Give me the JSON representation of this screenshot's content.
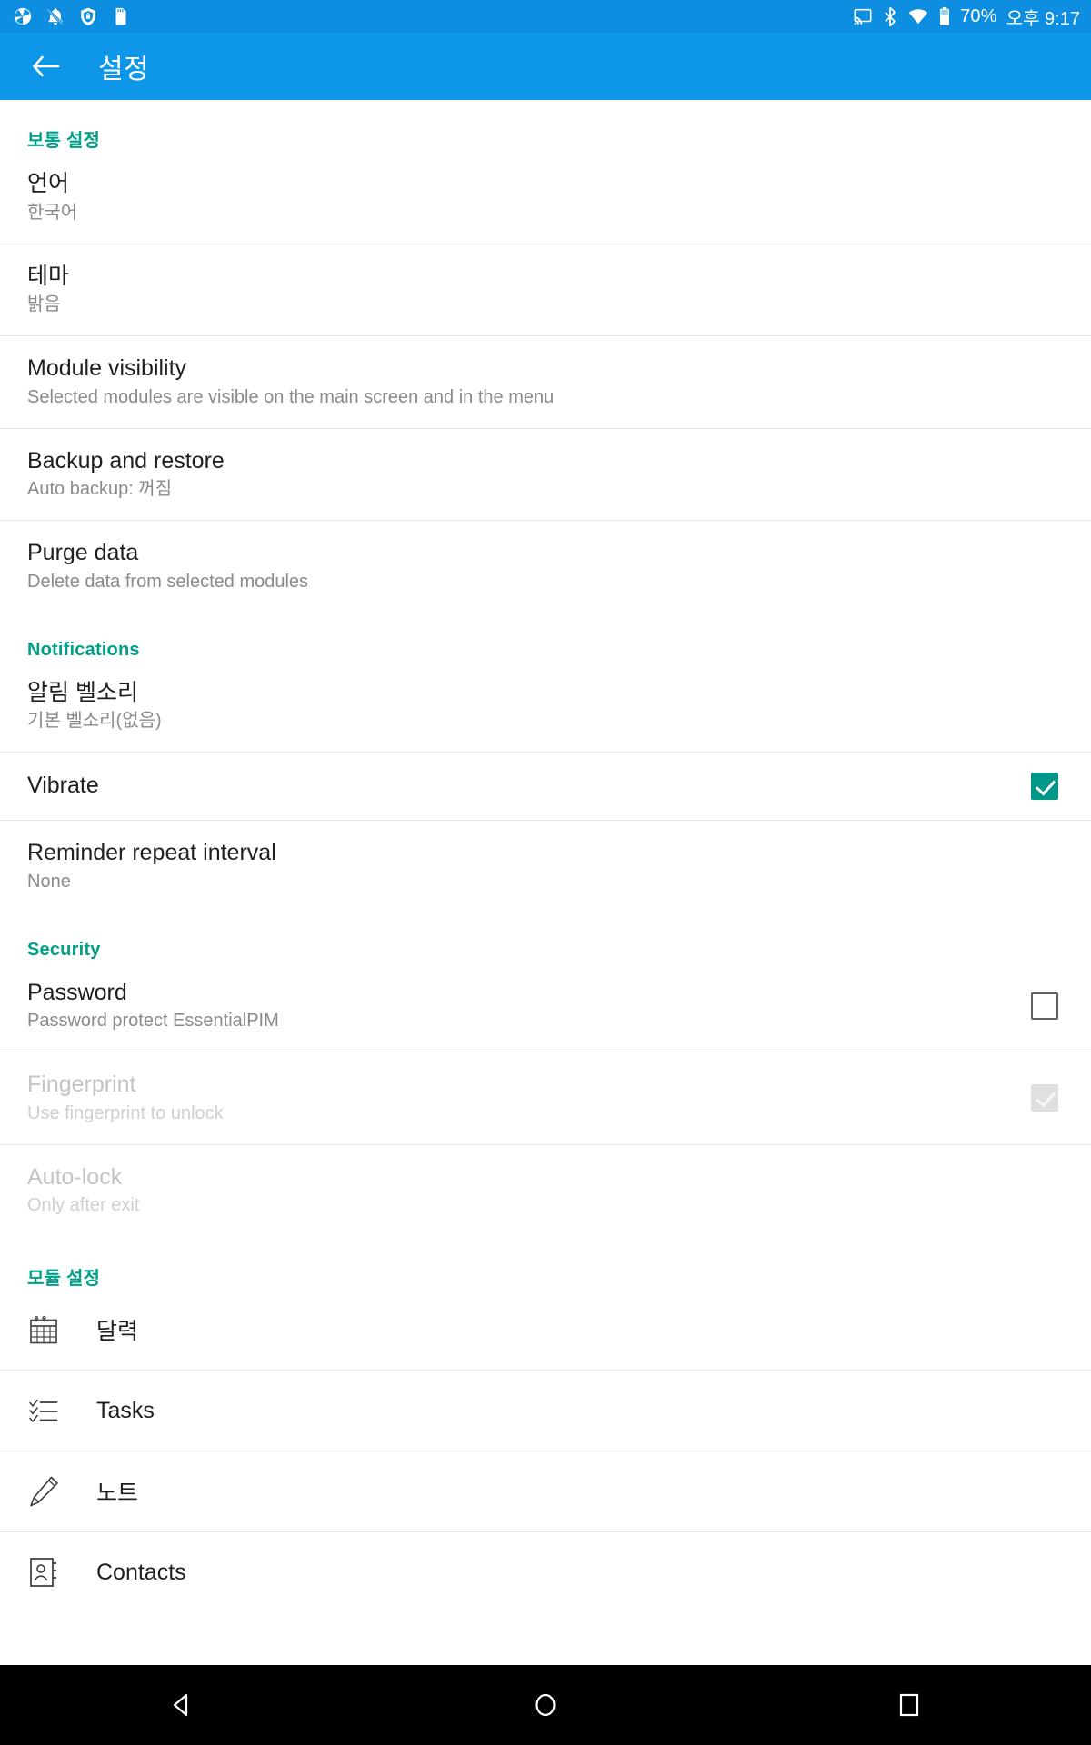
{
  "statusbar": {
    "left_icons": [
      "camera-icon",
      "notifications-off-icon",
      "shield-lock-icon",
      "sd-card-icon"
    ],
    "right_icons": [
      "cast-icon",
      "bluetooth-icon",
      "wifi-icon",
      "battery-icon"
    ],
    "battery_percent": "70%",
    "time": "오후 9:17"
  },
  "appbar": {
    "back_icon": "back-arrow-icon",
    "title": "설정"
  },
  "sections": [
    {
      "id": "general",
      "header": "보통 설정",
      "rows": [
        {
          "title": "언어",
          "sub": "한국어",
          "control": "none"
        },
        {
          "title": "테마",
          "sub": "밝음",
          "control": "none"
        },
        {
          "title": "Module visibility",
          "sub": "Selected modules are visible on the main screen and in the menu",
          "control": "none"
        },
        {
          "title": "Backup and restore",
          "sub": "Auto backup: 꺼짐",
          "control": "none"
        },
        {
          "title": "Purge data",
          "sub": "Delete data from selected modules",
          "control": "none"
        }
      ]
    },
    {
      "id": "notifications",
      "header": "Notifications",
      "rows": [
        {
          "title": "알림 벨소리",
          "sub": "기본 벨소리(없음)",
          "control": "none"
        },
        {
          "title": "Vibrate",
          "sub": "",
          "control": "checkbox",
          "checked": true,
          "disabled": false
        },
        {
          "title": "Reminder repeat interval",
          "sub": "None",
          "control": "none"
        }
      ]
    },
    {
      "id": "security",
      "header": "Security",
      "rows": [
        {
          "title": "Password",
          "sub": "Password protect EssentialPIM",
          "control": "checkbox",
          "checked": false,
          "disabled": false
        },
        {
          "title": "Fingerprint",
          "sub": "Use fingerprint to unlock",
          "control": "checkbox",
          "checked": true,
          "disabled": true
        },
        {
          "title": "Auto-lock",
          "sub": "Only after exit",
          "control": "none",
          "disabled": true
        }
      ]
    }
  ],
  "modules": {
    "header": "모듈 설정",
    "items": [
      {
        "label": "달력",
        "icon": "calendar-icon"
      },
      {
        "label": "Tasks",
        "icon": "checklist-icon"
      },
      {
        "label": "노트",
        "icon": "pen-icon"
      },
      {
        "label": "Contacts",
        "icon": "address-book-icon"
      }
    ]
  },
  "navbar": {
    "back": "nav-back-icon",
    "home": "nav-home-icon",
    "recents": "nav-recents-icon"
  },
  "colors": {
    "statusbar": "#0e8ee0",
    "appbar": "#0e97e8",
    "accent_teal": "#00a08a",
    "checkbox_checked": "#009688",
    "divider": "#e4e4e4"
  }
}
